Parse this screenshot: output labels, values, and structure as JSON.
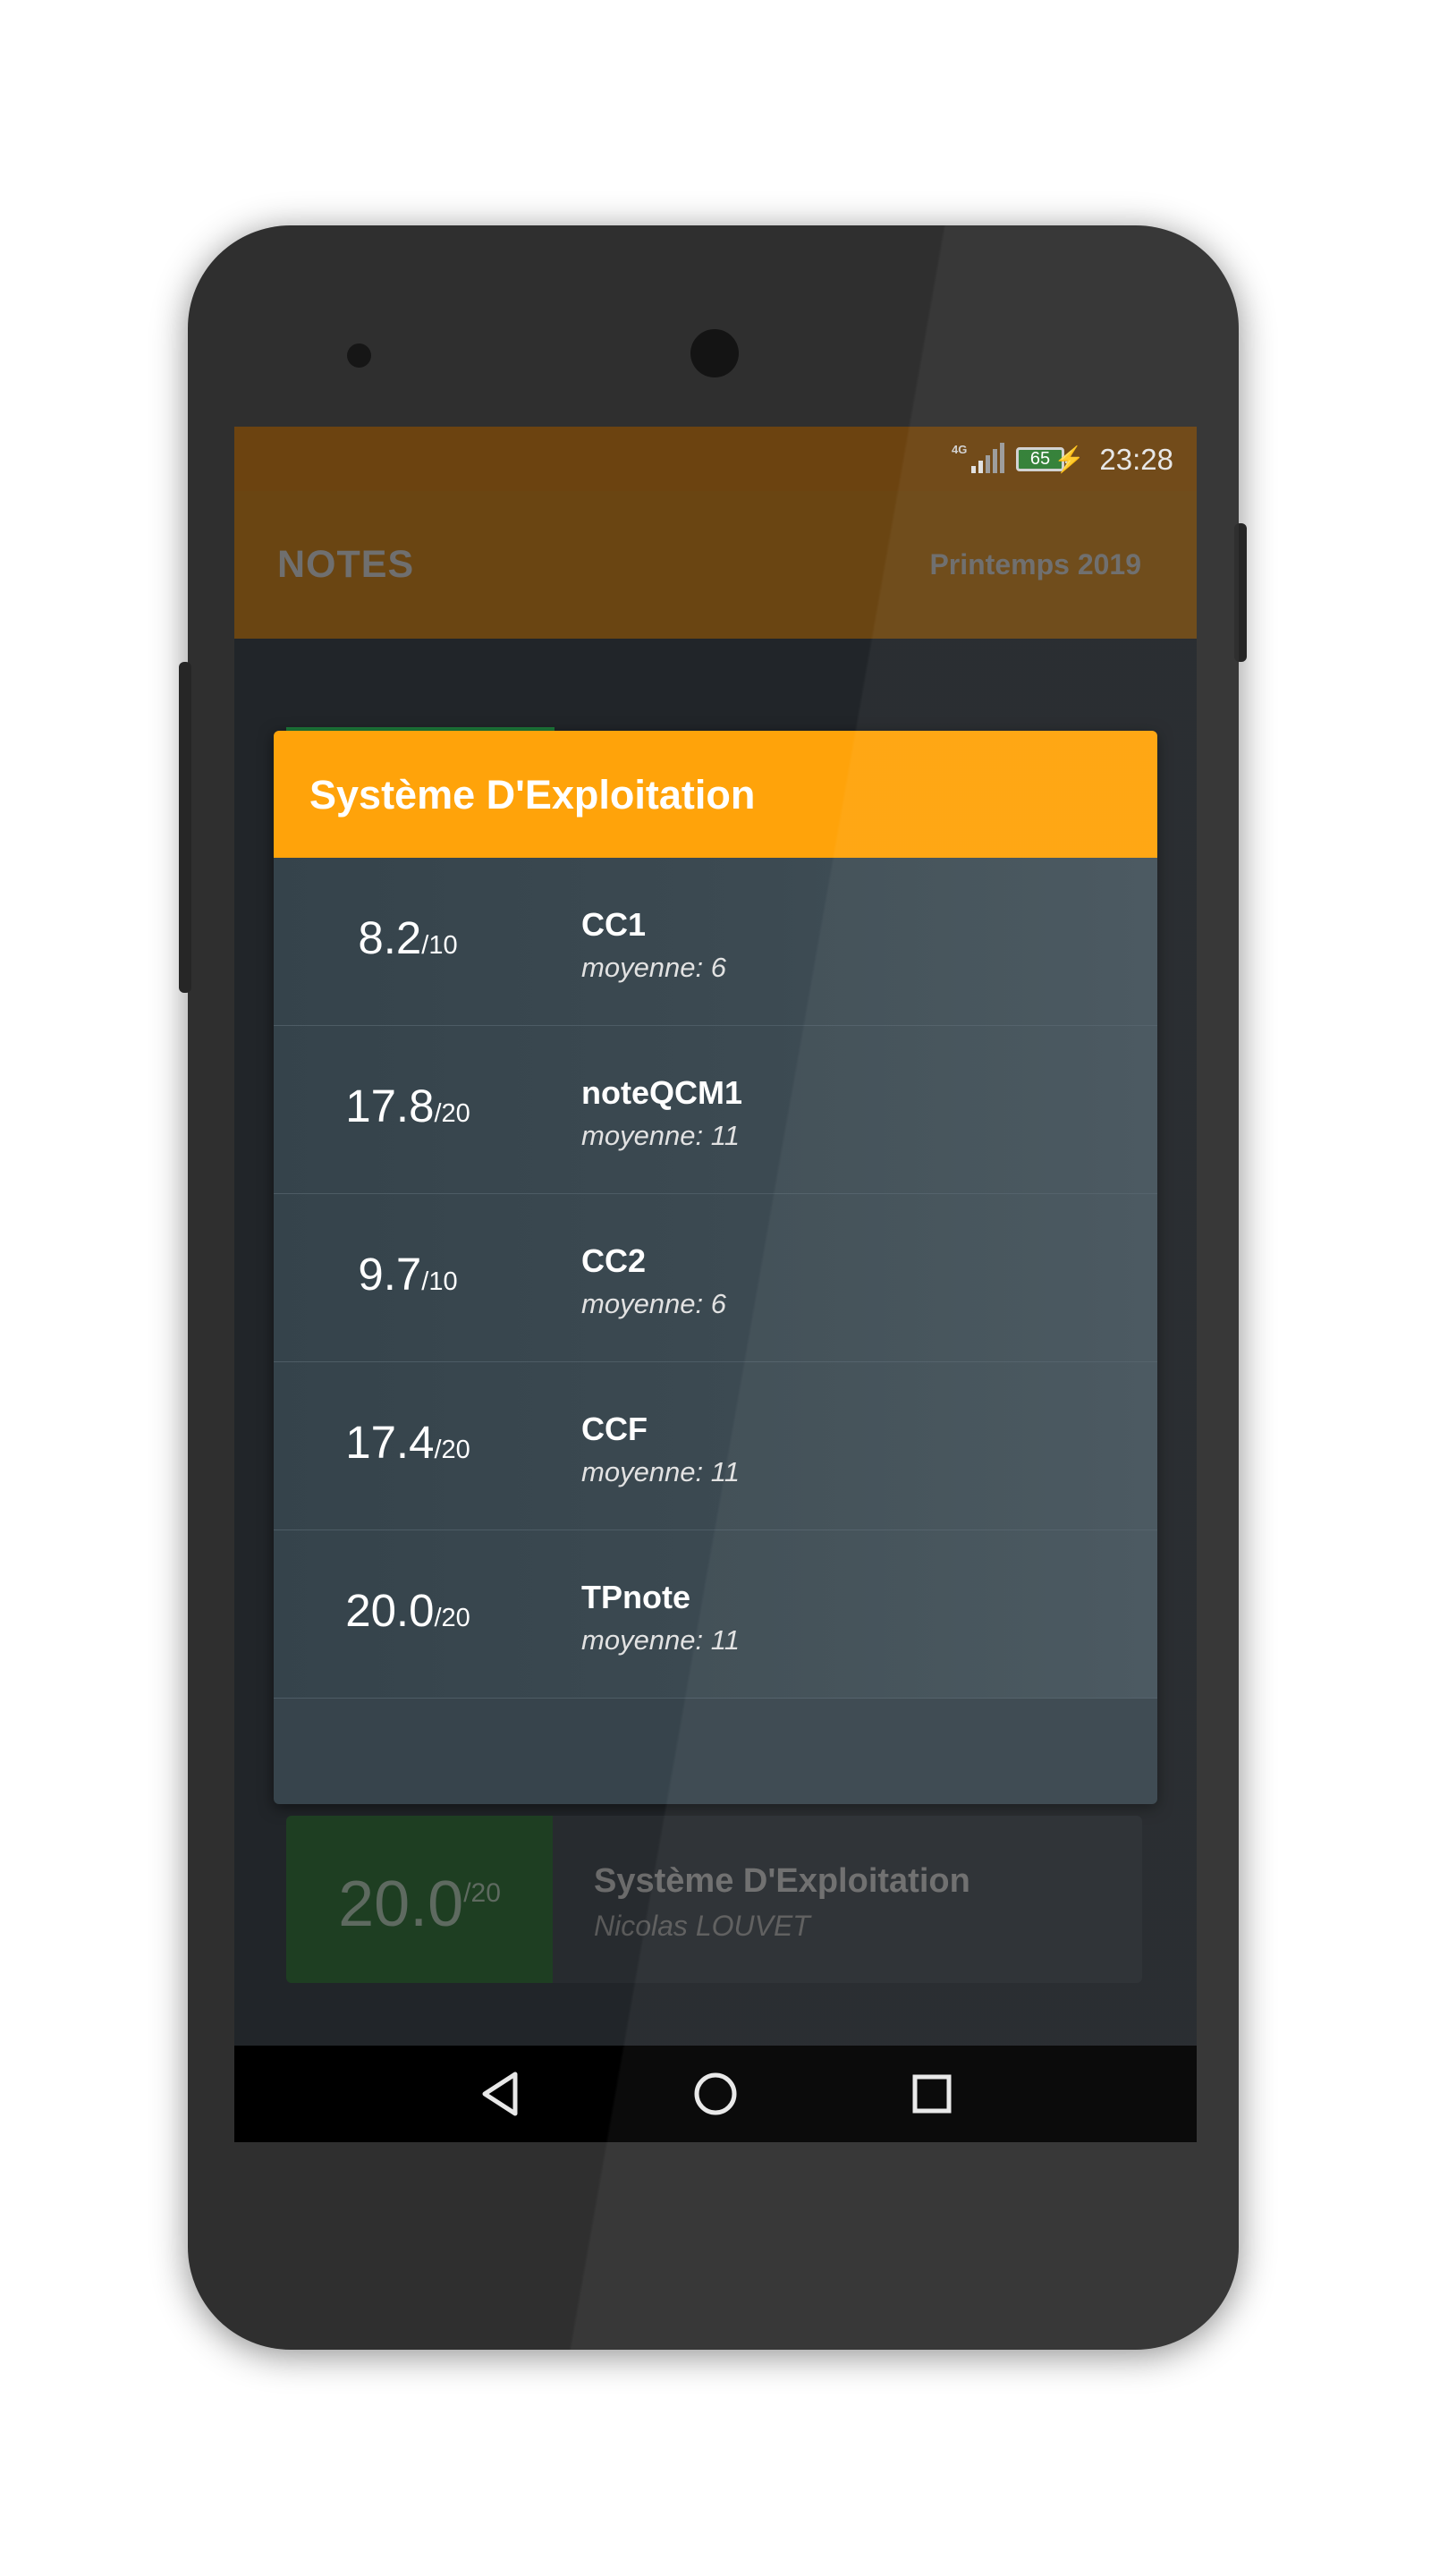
{
  "status_bar": {
    "network": "4G",
    "battery": "65",
    "time": "23:28"
  },
  "app_bar": {
    "title": "NOTES",
    "semester": "Printemps 2019"
  },
  "card": {
    "title": "Système D'Exploitation",
    "grades": [
      {
        "score": "8.2",
        "max": "/10",
        "name": "CC1",
        "average": "moyenne: 6"
      },
      {
        "score": "17.8",
        "max": "/20",
        "name": "noteQCM1",
        "average": "moyenne: 11"
      },
      {
        "score": "9.7",
        "max": "/10",
        "name": "CC2",
        "average": "moyenne: 6"
      },
      {
        "score": "17.4",
        "max": "/20",
        "name": "CCF",
        "average": "moyenne: 11"
      },
      {
        "score": "20.0",
        "max": "/20",
        "name": "TPnote",
        "average": "moyenne: 11"
      }
    ]
  },
  "course_item": {
    "score": "20.0",
    "max": "/20",
    "title": "Système D'Exploitation",
    "teacher": "Nicolas LOUVET"
  },
  "icons": {
    "back": "back-triangle-icon",
    "home": "home-circle-icon",
    "recents": "recents-square-icon"
  },
  "colors": {
    "accent": "#ffa30a",
    "app_bar": "#6a4512",
    "card": "#37444c",
    "success": "#1e3e22"
  }
}
